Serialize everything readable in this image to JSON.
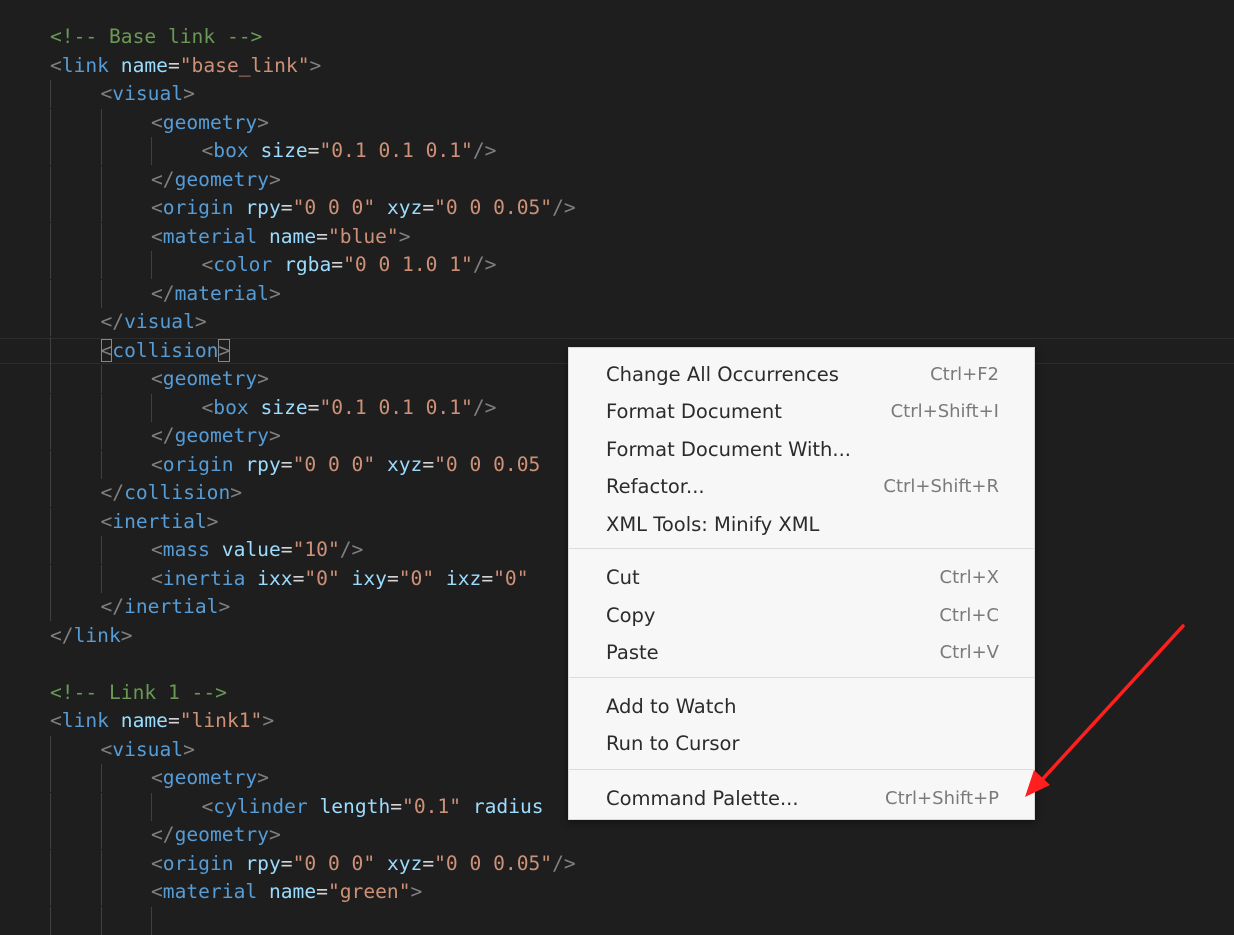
{
  "editor": {
    "lines": [
      {
        "indent": 0,
        "tokens": [
          [
            "cm",
            "<!-- Base link -->"
          ]
        ]
      },
      {
        "indent": 0,
        "tokens": [
          [
            "br",
            "<"
          ],
          [
            "tag",
            "link"
          ],
          [
            "eq",
            " "
          ],
          [
            "at",
            "name"
          ],
          [
            "eq",
            "="
          ],
          [
            "st",
            "\"base_link\""
          ],
          [
            "br",
            ">"
          ]
        ]
      },
      {
        "indent": 1,
        "tokens": [
          [
            "br",
            "<"
          ],
          [
            "tag",
            "visual"
          ],
          [
            "br",
            ">"
          ]
        ]
      },
      {
        "indent": 2,
        "tokens": [
          [
            "br",
            "<"
          ],
          [
            "tag",
            "geometry"
          ],
          [
            "br",
            ">"
          ]
        ]
      },
      {
        "indent": 3,
        "tokens": [
          [
            "br",
            "<"
          ],
          [
            "tag",
            "box"
          ],
          [
            "eq",
            " "
          ],
          [
            "at",
            "size"
          ],
          [
            "eq",
            "="
          ],
          [
            "st",
            "\"0.1 0.1 0.1\""
          ],
          [
            "br",
            "/>"
          ]
        ]
      },
      {
        "indent": 2,
        "tokens": [
          [
            "br",
            "</"
          ],
          [
            "tag",
            "geometry"
          ],
          [
            "br",
            ">"
          ]
        ]
      },
      {
        "indent": 2,
        "tokens": [
          [
            "br",
            "<"
          ],
          [
            "tag",
            "origin"
          ],
          [
            "eq",
            " "
          ],
          [
            "at",
            "rpy"
          ],
          [
            "eq",
            "="
          ],
          [
            "st",
            "\"0 0 0\""
          ],
          [
            "eq",
            " "
          ],
          [
            "at",
            "xyz"
          ],
          [
            "eq",
            "="
          ],
          [
            "st",
            "\"0 0 0.05\""
          ],
          [
            "br",
            "/>"
          ]
        ]
      },
      {
        "indent": 2,
        "tokens": [
          [
            "br",
            "<"
          ],
          [
            "tag",
            "material"
          ],
          [
            "eq",
            " "
          ],
          [
            "at",
            "name"
          ],
          [
            "eq",
            "="
          ],
          [
            "st",
            "\"blue\""
          ],
          [
            "br",
            ">"
          ]
        ]
      },
      {
        "indent": 3,
        "tokens": [
          [
            "br",
            "<"
          ],
          [
            "tag",
            "color"
          ],
          [
            "eq",
            " "
          ],
          [
            "at",
            "rgba"
          ],
          [
            "eq",
            "="
          ],
          [
            "st",
            "\"0 0 1.0 1\""
          ],
          [
            "br",
            "/>"
          ]
        ]
      },
      {
        "indent": 2,
        "tokens": [
          [
            "br",
            "</"
          ],
          [
            "tag",
            "material"
          ],
          [
            "br",
            ">"
          ]
        ]
      },
      {
        "indent": 1,
        "tokens": [
          [
            "br",
            "</"
          ],
          [
            "tag",
            "visual"
          ],
          [
            "br",
            ">"
          ]
        ]
      },
      {
        "indent": 1,
        "tokens": [
          [
            "bm",
            "<"
          ],
          [
            "tag",
            "collision"
          ],
          [
            "bm",
            ">"
          ]
        ]
      },
      {
        "indent": 2,
        "tokens": [
          [
            "br",
            "<"
          ],
          [
            "tag",
            "geometry"
          ],
          [
            "br",
            ">"
          ]
        ]
      },
      {
        "indent": 3,
        "tokens": [
          [
            "br",
            "<"
          ],
          [
            "tag",
            "box"
          ],
          [
            "eq",
            " "
          ],
          [
            "at",
            "size"
          ],
          [
            "eq",
            "="
          ],
          [
            "st",
            "\"0.1 0.1 0.1\""
          ],
          [
            "br",
            "/>"
          ]
        ]
      },
      {
        "indent": 2,
        "tokens": [
          [
            "br",
            "</"
          ],
          [
            "tag",
            "geometry"
          ],
          [
            "br",
            ">"
          ]
        ]
      },
      {
        "indent": 2,
        "tokens": [
          [
            "br",
            "<"
          ],
          [
            "tag",
            "origin"
          ],
          [
            "eq",
            " "
          ],
          [
            "at",
            "rpy"
          ],
          [
            "eq",
            "="
          ],
          [
            "st",
            "\"0 0 0\""
          ],
          [
            "eq",
            " "
          ],
          [
            "at",
            "xyz"
          ],
          [
            "eq",
            "="
          ],
          [
            "st",
            "\"0 0 0.05"
          ]
        ]
      },
      {
        "indent": 1,
        "tokens": [
          [
            "br",
            "</"
          ],
          [
            "tag",
            "collision"
          ],
          [
            "br",
            ">"
          ]
        ]
      },
      {
        "indent": 1,
        "tokens": [
          [
            "br",
            "<"
          ],
          [
            "tag",
            "inertial"
          ],
          [
            "br",
            ">"
          ]
        ]
      },
      {
        "indent": 2,
        "tokens": [
          [
            "br",
            "<"
          ],
          [
            "tag",
            "mass"
          ],
          [
            "eq",
            " "
          ],
          [
            "at",
            "value"
          ],
          [
            "eq",
            "="
          ],
          [
            "st",
            "\"10\""
          ],
          [
            "br",
            "/>"
          ]
        ]
      },
      {
        "indent": 2,
        "tokens": [
          [
            "br",
            "<"
          ],
          [
            "tag",
            "inertia"
          ],
          [
            "eq",
            " "
          ],
          [
            "at",
            "ixx"
          ],
          [
            "eq",
            "="
          ],
          [
            "st",
            "\"0\""
          ],
          [
            "eq",
            " "
          ],
          [
            "at",
            "ixy"
          ],
          [
            "eq",
            "="
          ],
          [
            "st",
            "\"0\""
          ],
          [
            "eq",
            " "
          ],
          [
            "at",
            "ixz"
          ],
          [
            "eq",
            "="
          ],
          [
            "st",
            "\"0\""
          ]
        ]
      },
      {
        "indent": 1,
        "tokens": [
          [
            "br",
            "</"
          ],
          [
            "tag",
            "inertial"
          ],
          [
            "br",
            ">"
          ]
        ]
      },
      {
        "indent": 0,
        "tokens": [
          [
            "br",
            "</"
          ],
          [
            "tag",
            "link"
          ],
          [
            "br",
            ">"
          ]
        ]
      },
      {
        "indent": 0,
        "tokens": []
      },
      {
        "indent": 0,
        "tokens": [
          [
            "cm",
            "<!-- Link 1 -->"
          ]
        ]
      },
      {
        "indent": 0,
        "tokens": [
          [
            "br",
            "<"
          ],
          [
            "tag",
            "link"
          ],
          [
            "eq",
            " "
          ],
          [
            "at",
            "name"
          ],
          [
            "eq",
            "="
          ],
          [
            "st",
            "\"link1\""
          ],
          [
            "br",
            ">"
          ]
        ]
      },
      {
        "indent": 1,
        "tokens": [
          [
            "br",
            "<"
          ],
          [
            "tag",
            "visual"
          ],
          [
            "br",
            ">"
          ]
        ]
      },
      {
        "indent": 2,
        "tokens": [
          [
            "br",
            "<"
          ],
          [
            "tag",
            "geometry"
          ],
          [
            "br",
            ">"
          ]
        ]
      },
      {
        "indent": 3,
        "tokens": [
          [
            "br",
            "<"
          ],
          [
            "tag",
            "cylinder"
          ],
          [
            "eq",
            " "
          ],
          [
            "at",
            "length"
          ],
          [
            "eq",
            "="
          ],
          [
            "st",
            "\"0.1\""
          ],
          [
            "eq",
            " "
          ],
          [
            "at",
            "radius"
          ]
        ]
      },
      {
        "indent": 2,
        "tokens": [
          [
            "br",
            "</"
          ],
          [
            "tag",
            "geometry"
          ],
          [
            "br",
            ">"
          ]
        ]
      },
      {
        "indent": 2,
        "tokens": [
          [
            "br",
            "<"
          ],
          [
            "tag",
            "origin"
          ],
          [
            "eq",
            " "
          ],
          [
            "at",
            "rpy"
          ],
          [
            "eq",
            "="
          ],
          [
            "st",
            "\"0 0 0\""
          ],
          [
            "eq",
            " "
          ],
          [
            "at",
            "xyz"
          ],
          [
            "eq",
            "="
          ],
          [
            "st",
            "\"0 0 0.05\""
          ],
          [
            "br",
            "/>"
          ]
        ]
      },
      {
        "indent": 2,
        "tokens": [
          [
            "br",
            "<"
          ],
          [
            "tag",
            "material"
          ],
          [
            "eq",
            " "
          ],
          [
            "at",
            "name"
          ],
          [
            "eq",
            "="
          ],
          [
            "st",
            "\"green\""
          ],
          [
            "br",
            ">"
          ]
        ]
      },
      {
        "indent": 3,
        "tokens": []
      }
    ]
  },
  "context_menu": {
    "groups": [
      [
        {
          "label": "Change All Occurrences",
          "shortcut": "Ctrl+F2"
        },
        {
          "label": "Format Document",
          "shortcut": "Ctrl+Shift+I"
        },
        {
          "label": "Format Document With...",
          "shortcut": ""
        },
        {
          "label": "Refactor...",
          "shortcut": "Ctrl+Shift+R"
        },
        {
          "label": "XML Tools: Minify XML",
          "shortcut": ""
        }
      ],
      [
        {
          "label": "Cut",
          "shortcut": "Ctrl+X"
        },
        {
          "label": "Copy",
          "shortcut": "Ctrl+C"
        },
        {
          "label": "Paste",
          "shortcut": "Ctrl+V"
        }
      ],
      [
        {
          "label": "Add to Watch",
          "shortcut": ""
        },
        {
          "label": "Run to Cursor",
          "shortcut": ""
        }
      ],
      [
        {
          "label": "Command Palette...",
          "shortcut": "Ctrl+Shift+P"
        }
      ]
    ]
  },
  "annotation": {
    "arrow_color": "#ff1f1f"
  },
  "colors": {
    "background": "#1e1e1e",
    "comment": "#6a9955",
    "bracket": "#808080",
    "tag": "#569cd6",
    "attribute": "#9cdcfe",
    "string": "#ce9178",
    "menu_bg": "#f7f7f7"
  }
}
